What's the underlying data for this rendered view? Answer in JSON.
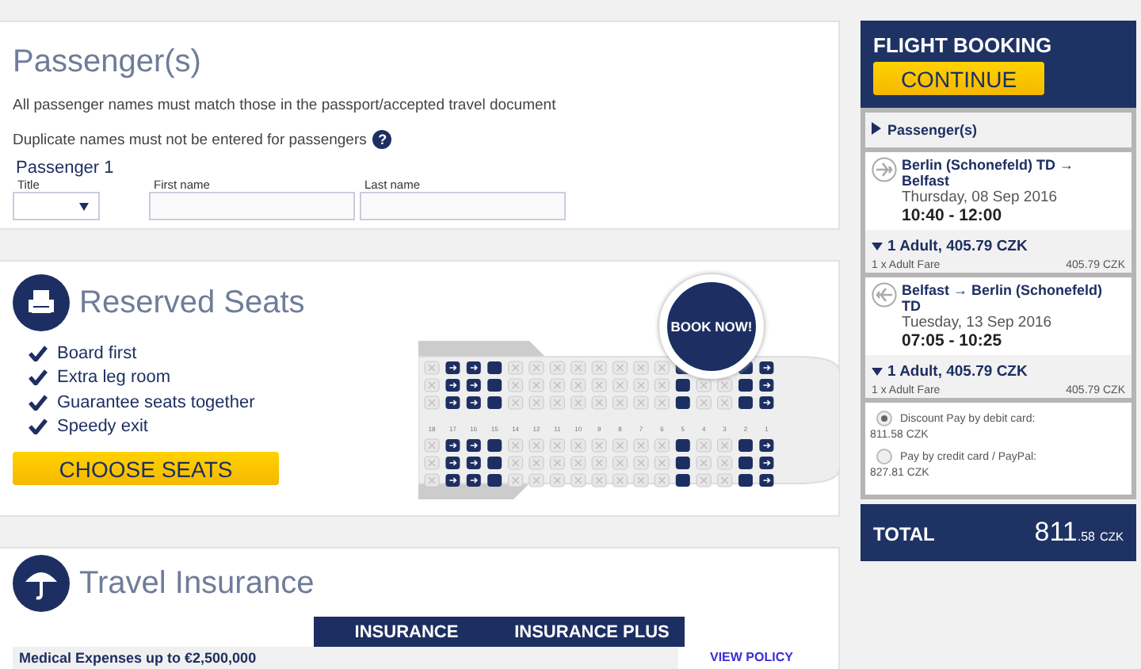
{
  "passengers": {
    "title": "Passenger(s)",
    "notes": [
      "All passenger names must match those in the passport/accepted travel document",
      "Duplicate names must not be entered for passengers"
    ],
    "help_mark": "?",
    "passenger_label": "Passenger 1",
    "fields": [
      {
        "kind": "select",
        "label": "Title"
      },
      {
        "kind": "text",
        "label": "First name"
      },
      {
        "kind": "text",
        "label": "Last name"
      }
    ]
  },
  "seats": {
    "title": "Reserved Seats",
    "benefits": [
      "Board first",
      "Extra leg room",
      "Guarantee seats together",
      "Speedy exit"
    ],
    "button": "CHOOSE SEATS",
    "badge": "BOOK NOW!",
    "seat_map": [
      {
        "number": "18",
        "kind": "blocked"
      },
      {
        "number": "17",
        "kind": "priority"
      },
      {
        "number": "16",
        "kind": "priority"
      },
      {
        "number": "15",
        "kind": "reserved"
      },
      {
        "number": "14",
        "kind": "blocked"
      },
      {
        "number": "12",
        "kind": "blocked"
      },
      {
        "number": "11",
        "kind": "blocked"
      },
      {
        "number": "10",
        "kind": "blocked"
      },
      {
        "number": "9",
        "kind": "blocked"
      },
      {
        "number": "8",
        "kind": "blocked"
      },
      {
        "number": "7",
        "kind": "blocked"
      },
      {
        "number": "6",
        "kind": "blocked"
      },
      {
        "number": "5",
        "kind": "reserved"
      },
      {
        "number": "4",
        "kind": "blocked"
      },
      {
        "number": "3",
        "kind": "blocked"
      },
      {
        "number": "2",
        "kind": "reserved"
      },
      {
        "number": "1",
        "kind": "priority"
      }
    ]
  },
  "insurance": {
    "title": "Travel Insurance",
    "columns": [
      "INSURANCE",
      "INSURANCE PLUS"
    ],
    "rows": [
      {
        "label": "Medical Expenses up to €2,500,000",
        "link": "VIEW POLICY"
      }
    ]
  },
  "booking": {
    "title": "FLIGHT BOOKING",
    "button": "CONTINUE",
    "section": "Passenger(s)",
    "section_expanded": false,
    "flights": [
      {
        "route": "Berlin (Schonefeld) TD → Belfast",
        "date": "Thursday, 08 Sep 2016",
        "time": "10:40 - 12:00",
        "fare_summary": "1 Adult, 405.79 CZK",
        "fare_expanded": true,
        "fare_label": "1 x Adult Fare",
        "fare_amount": "405.79 CZK"
      },
      {
        "route": "Belfast → Berlin (Schonefeld) TD",
        "date": "Tuesday, 13 Sep 2016",
        "time": "07:05 - 10:25",
        "fare_summary": "1 Adult, 405.79 CZK",
        "fare_expanded": true,
        "fare_label": "1 x Adult Fare",
        "fare_amount": "405.79 CZK"
      }
    ],
    "payments": [
      {
        "label": "Discount Pay by debit card:",
        "amount": "811.58 CZK",
        "selected": true
      },
      {
        "label": "Pay by credit card / PayPal:",
        "amount": "827.81 CZK",
        "selected": false
      }
    ],
    "total_label": "TOTAL",
    "total_main": "811",
    "total_cents": ".58",
    "total_currency": "CZK"
  }
}
